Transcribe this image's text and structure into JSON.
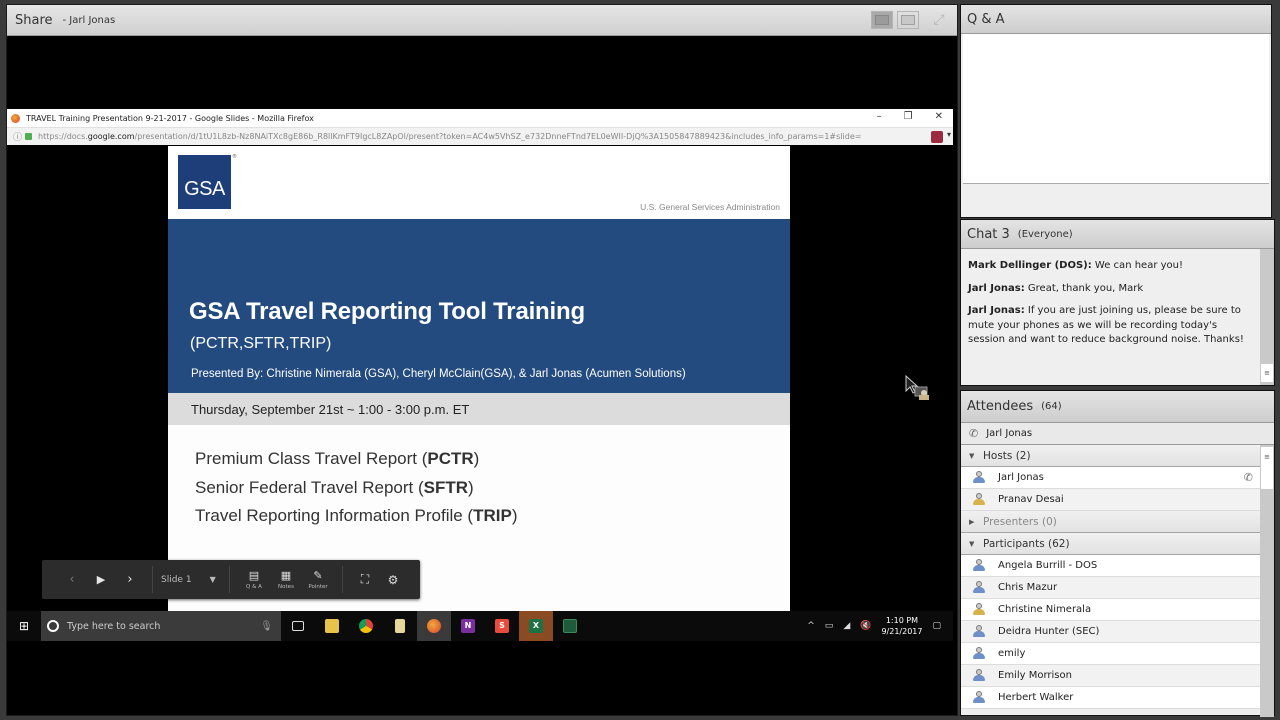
{
  "share_pod": {
    "title": "Share",
    "presenter": "- Jarl Jonas",
    "tools": [
      "fit-to-window-icon",
      "actual-size-icon",
      "fullscreen-icon"
    ]
  },
  "browser": {
    "window_title": "TRAVEL Training Presentation 9-21-2017 - Google Slides - Mozilla Firefox",
    "url_prefix": "https://docs.",
    "url_domain": "google.com",
    "url_rest": "/presentation/d/1tU1L8zb-Nz8NAiTXc8gE86b_R8llKmFT9IgcL8ZApOl/present?token=AC4w5VhSZ_e732DnneFTnd7EL0eWII-DjQ%3A1505847889423&includes_info_params=1#slide=",
    "controls": {
      "minimize": "–",
      "restore": "❐",
      "close": "✕"
    }
  },
  "slide": {
    "logo_text": "GSA",
    "agency": "U.S. General Services Administration",
    "title": "GSA Travel Reporting Tool Training",
    "subtitle": "(PCTR,SFTR,TRIP)",
    "presenters": "Presented By: Christine Nimerala (GSA), Cheryl McClain(GSA), & Jarl Jonas (Acumen Solutions)",
    "date": "Thursday, September 21st ~ 1:00 - 3:00 p.m. ET",
    "items": [
      {
        "text": "Premium Class Travel Report (",
        "abbr": "PCTR",
        "close": ")"
      },
      {
        "text": "Senior Federal Travel Report (",
        "abbr": "SFTR",
        "close": ")"
      },
      {
        "text": "Travel Reporting Information Profile (",
        "abbr": "TRIP",
        "close": ")"
      }
    ],
    "colors": {
      "band": "#234b7f",
      "logo": "#1d3e78",
      "date_band": "#dcdcdc"
    }
  },
  "presenter_toolbar": {
    "prev": "‹",
    "play": "▶",
    "next": "›",
    "slide_select": "Slide 1",
    "tools": [
      {
        "label": "Q & A",
        "icon": "qa-icon"
      },
      {
        "label": "Notes",
        "icon": "notes-icon"
      },
      {
        "label": "Pointer",
        "icon": "pointer-icon"
      }
    ]
  },
  "taskbar": {
    "search_placeholder": "Type here to search",
    "apps": [
      "task-view",
      "file-explorer",
      "chrome",
      "files",
      "firefox",
      "onenote",
      "app-s",
      "excel",
      "excel-2"
    ],
    "time": "1:10 PM",
    "date": "9/21/2017"
  },
  "qa_pod": {
    "title": "Q & A"
  },
  "chat_pod": {
    "title": "Chat 3",
    "scope": "(Everyone)",
    "messages": [
      {
        "sender": "Mark Dellinger (DOS):",
        "text": " We can hear you!"
      },
      {
        "sender": "Jarl Jonas:",
        "text": " Great, thank you, Mark"
      },
      {
        "sender": "Jarl Jonas:",
        "text": " If you are just joining us, please be sure to mute your phones as we will be recording today's session and want to reduce background noise. Thanks!"
      }
    ]
  },
  "attendees_pod": {
    "title": "Attendees",
    "count": "(64)",
    "self": "Jarl Jonas",
    "groups": {
      "hosts": {
        "label": "Hosts (2)",
        "members": [
          "Jarl Jonas",
          "Pranav Desai"
        ]
      },
      "presenters": {
        "label": "Presenters (0)"
      },
      "participants": {
        "label": "Participants (62)",
        "members": [
          "Angela Burrill - DOS",
          "Chris Mazur",
          "Christine Nimerala",
          "Deidra Hunter (SEC)",
          "emily",
          "Emily Morrison",
          "Herbert Walker"
        ]
      }
    },
    "colors": {
      "host": "#d8b24a",
      "participant": "#6f8fc8",
      "participant_alt": "#d8b24a"
    }
  }
}
